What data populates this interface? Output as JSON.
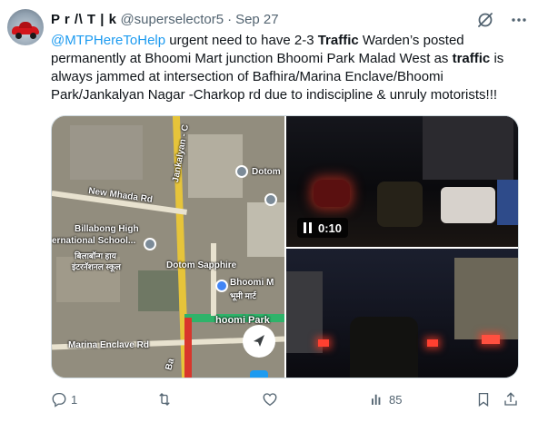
{
  "user": {
    "display_name": "P r /\\ T | k",
    "handle": "@superselector5",
    "separator": "·",
    "date": "Sep 27"
  },
  "tweet": {
    "parts": [
      {
        "text": "@MTPHereToHelp",
        "style": "mention"
      },
      {
        "text": " urgent need to have 2-3 ",
        "style": "normal"
      },
      {
        "text": "Traffic",
        "style": "bold"
      },
      {
        "text": " Warden’s posted permanently at Bhoomi Mart junction Bhoomi Park Malad West as ",
        "style": "normal"
      },
      {
        "text": "traffic",
        "style": "bold"
      },
      {
        "text": " is always jammed at intersection of Bafhira/Marina Enclave/Bhoomi Park/Jankalyan Nagar -Charkop rd due to indiscipline & unruly motorists!!!",
        "style": "normal"
      }
    ]
  },
  "media": {
    "map_labels": {
      "jankalyan": "Jankalyan - C",
      "dotom_top": "Dotom",
      "new_mhada": "New Mhada Rd",
      "billabong1": "Billabong High",
      "billabong2": "ernational School...",
      "billabong_hi1": "बिलाबॉन्ग हाय",
      "billabong_hi2": "इंटरनॅशनल स्कूल",
      "dotom_sapphire": "Dotom Sapphire",
      "bhoomi": "Bhoomi M",
      "bhoomi_hi": "भूमी मार्ट",
      "bhoomi_park": "hoomi Park",
      "marina": "Marina Enclave Rd",
      "ba": "Ba"
    },
    "video_time": "0:10"
  },
  "actions": {
    "replies": "1",
    "retweets": "",
    "likes": "",
    "views": "85"
  },
  "icons": {
    "grok": "grok-icon",
    "more": "more-icon",
    "reply": "reply-icon",
    "retweet": "retweet-icon",
    "like": "heart-icon",
    "views": "views-icon",
    "bookmark": "bookmark-icon",
    "share": "share-icon",
    "play": "pause-icon",
    "navigate": "navigation-arrow-icon"
  },
  "colors": {
    "link": "#1d9bf0",
    "text": "#0f1419",
    "secondary": "#536471"
  }
}
